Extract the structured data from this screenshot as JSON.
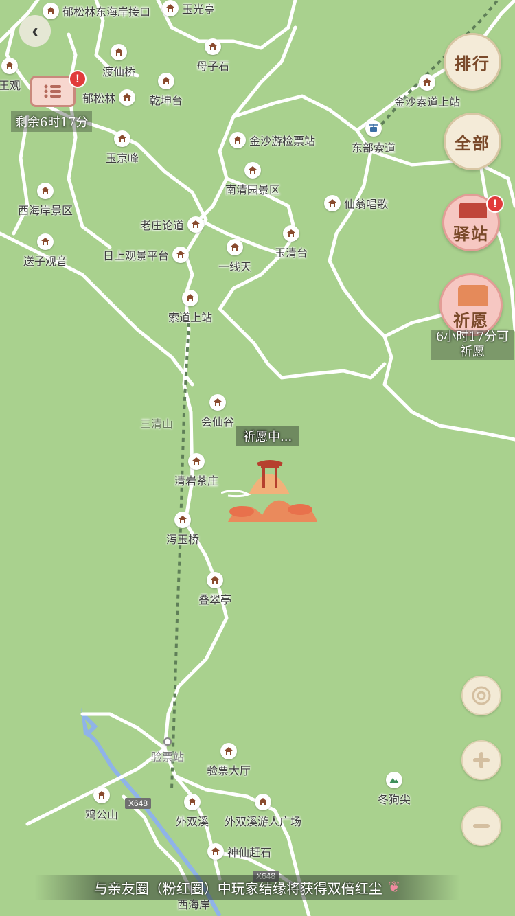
{
  "nav": {
    "back_icon": "chevron-left-icon"
  },
  "scroll_task": {
    "icon": "scroll-list-icon",
    "badge": "!",
    "countdown": "剩余6时17分"
  },
  "side_buttons": {
    "ranking": "排行",
    "all": "全部",
    "station": "驿站",
    "station_badge": "!",
    "wish": "祈愿",
    "wish_countdown_line1": "6小时17分可",
    "wish_countdown_line2": "祈愿"
  },
  "wishing_status": "祈愿中...",
  "pois": [
    {
      "label": "郁松林东海岸接口"
    },
    {
      "label": "玉光亭"
    },
    {
      "label": "渡仙桥"
    },
    {
      "label": "母子石"
    },
    {
      "label": "王观"
    },
    {
      "label": "郁松林"
    },
    {
      "label": "乾坤台"
    },
    {
      "label": "金沙索道上站"
    },
    {
      "label": "玉京峰"
    },
    {
      "label": "金沙游检票站"
    },
    {
      "label": "东部索道"
    },
    {
      "label": "南清园景区"
    },
    {
      "label": "西海岸景区"
    },
    {
      "label": "仙翁唱歌"
    },
    {
      "label": "老庄论道"
    },
    {
      "label": "玉清台"
    },
    {
      "label": "送子观音"
    },
    {
      "label": "日上观景平台"
    },
    {
      "label": "一线天"
    },
    {
      "label": "索道上站"
    },
    {
      "label": "会仙谷"
    },
    {
      "label": "清岩茶庄"
    },
    {
      "label": "泻玉桥"
    },
    {
      "label": "叠翠亭"
    },
    {
      "label": "验票站"
    },
    {
      "label": "验票大厅"
    },
    {
      "label": "冬狗尖"
    },
    {
      "label": "鸡公山"
    },
    {
      "label": "外双溪"
    },
    {
      "label": "外双溪游人广场"
    },
    {
      "label": "神仙赶石"
    },
    {
      "label": "西海岸"
    }
  ],
  "area_label": "三清山",
  "road_tags": [
    "X648",
    "X648"
  ],
  "controls": {
    "locate_icon": "target-icon",
    "zoom_in_icon": "plus-icon",
    "zoom_out_icon": "minus-icon"
  },
  "bottom_banner": "与亲友圈（粉红圈）中玩家结缘将获得双倍红尘",
  "colors": {
    "land": "#a9d18e",
    "road": "#ffffff",
    "water": "#8fb3e8",
    "accent": "#7a4a2a",
    "alert": "#e13b3b"
  }
}
